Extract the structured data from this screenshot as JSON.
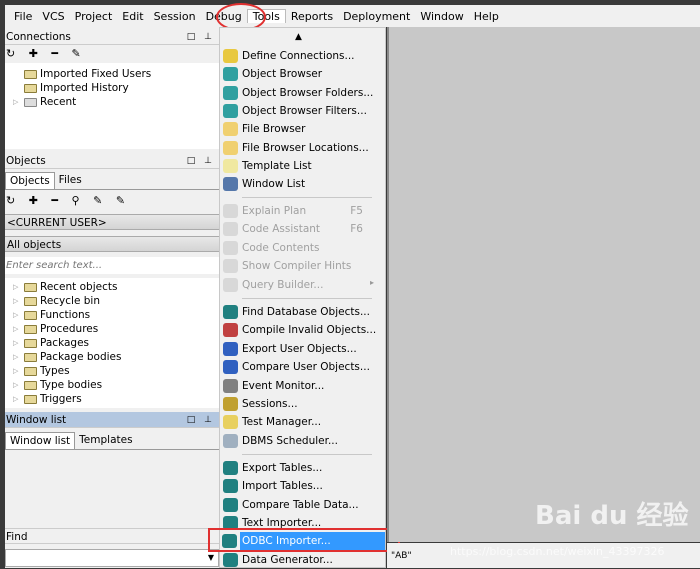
{
  "menubar": [
    "File",
    "VCS",
    "Project",
    "Edit",
    "Session",
    "Debug",
    "Tools",
    "Reports",
    "Deployment",
    "Window",
    "Help"
  ],
  "connections": {
    "title": "Connections",
    "toolbar": "↻ ✚ ━ ✎",
    "items": [
      "Imported Fixed Users",
      "Imported History",
      "Recent"
    ]
  },
  "objects": {
    "title": "Objects",
    "tabs": [
      "Objects",
      "Files"
    ],
    "toolbar": "↻ ✚ ━ ⚲ ✎ ✎",
    "user": "<CURRENT USER>",
    "filter": "All objects",
    "search_placeholder": "Enter search text...",
    "items": [
      "Recent objects",
      "Recycle bin",
      "Functions",
      "Procedures",
      "Packages",
      "Package bodies",
      "Types",
      "Type bodies",
      "Triggers"
    ]
  },
  "window_list": {
    "title": "Window list",
    "tabs": [
      "Window list",
      "Templates"
    ]
  },
  "find": {
    "title": "Find"
  },
  "tools_menu": {
    "group1": [
      "Define Connections...",
      "Object Browser",
      "Object Browser Folders...",
      "Object Browser Filters...",
      "File Browser",
      "File Browser Locations...",
      "Template List",
      "Window List"
    ],
    "group2": [
      {
        "label": "Explain Plan",
        "shortcut": "F5"
      },
      {
        "label": "Code Assistant",
        "shortcut": "F6"
      },
      {
        "label": "Code Contents"
      },
      {
        "label": "Show Compiler Hints"
      },
      {
        "label": "Query Builder..."
      }
    ],
    "group3": [
      "Find Database Objects...",
      "Compile Invalid Objects...",
      "Export User Objects...",
      "Compare User Objects...",
      "Event Monitor...",
      "Sessions...",
      "Test Manager...",
      "DBMS Scheduler..."
    ],
    "group4": [
      "Export Tables...",
      "Import Tables...",
      "Compare Table Data...",
      "Text Importer...",
      "ODBC Importer...",
      "Data Generator..."
    ],
    "highlighted": "ODBC Importer..."
  },
  "status": {
    "text": "\"AB\""
  },
  "watermark": "Baidu 经验 https://blog.csdn.net/weixin_43397326",
  "colors": {
    "highlight": "#3399ff",
    "annotation": "#e03030",
    "selected_panel": "#b3c7e0"
  }
}
